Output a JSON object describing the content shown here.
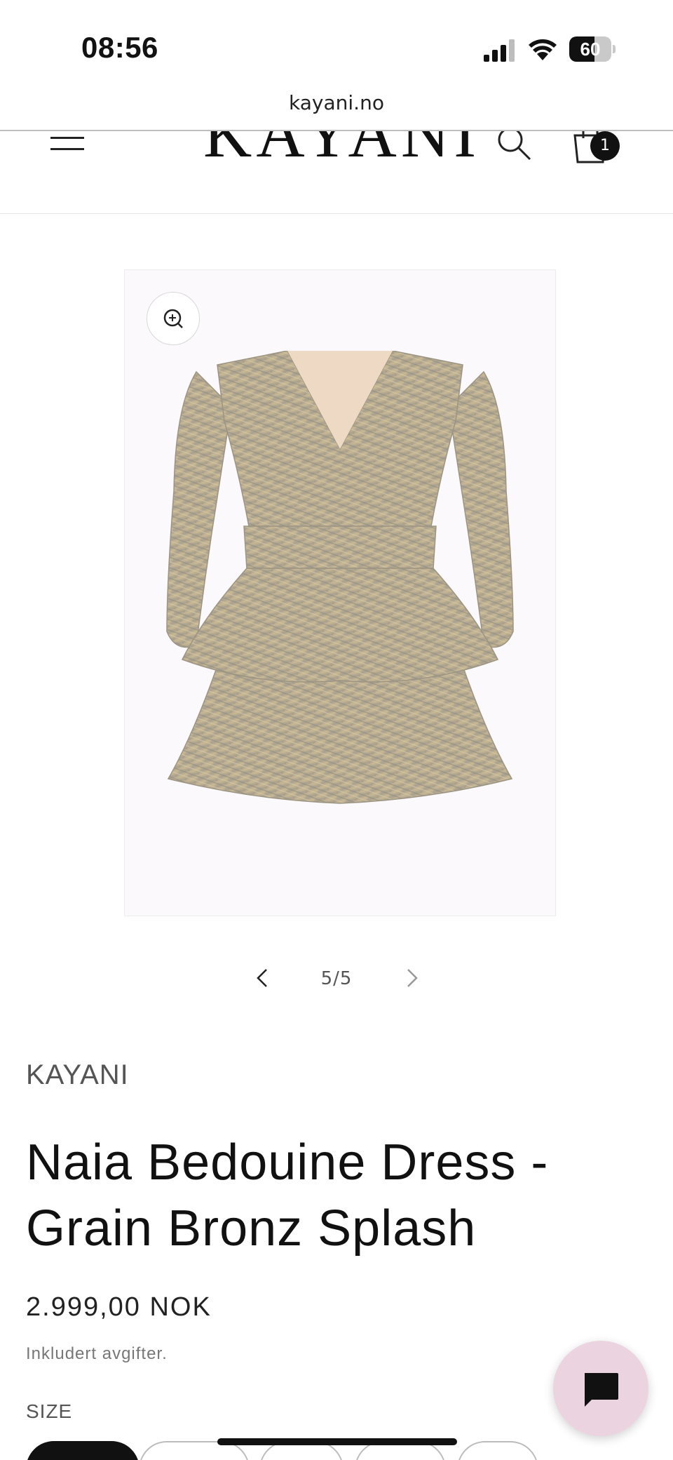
{
  "status_bar": {
    "time": "08:56",
    "battery_level": "60",
    "battery_fraction": 0.6,
    "icons": [
      "signal-icon",
      "wifi-icon",
      "battery-icon"
    ]
  },
  "browser": {
    "url": "kayani.no"
  },
  "header": {
    "logo": "KAYANI",
    "cart_count": "1",
    "icons": [
      "menu-icon",
      "search-icon",
      "cart-icon"
    ]
  },
  "media": {
    "slide_counter": "5/5",
    "icons": [
      "zoom-icon",
      "chevron-left-icon",
      "chevron-right-icon"
    ]
  },
  "product": {
    "vendor": "KAYANI",
    "title": "Naia Bedouine Dress - Grain Bronz Splash",
    "price": "2.999,00 NOK",
    "tax_note": "Inkludert avgifter.",
    "size_label": "SIZE"
  },
  "chat": {
    "icon": "chat-icon",
    "background_color": "#ecd3e0"
  },
  "colors": {
    "text": "#121212",
    "muted": "#555555",
    "fabric": "#b9ac94"
  }
}
